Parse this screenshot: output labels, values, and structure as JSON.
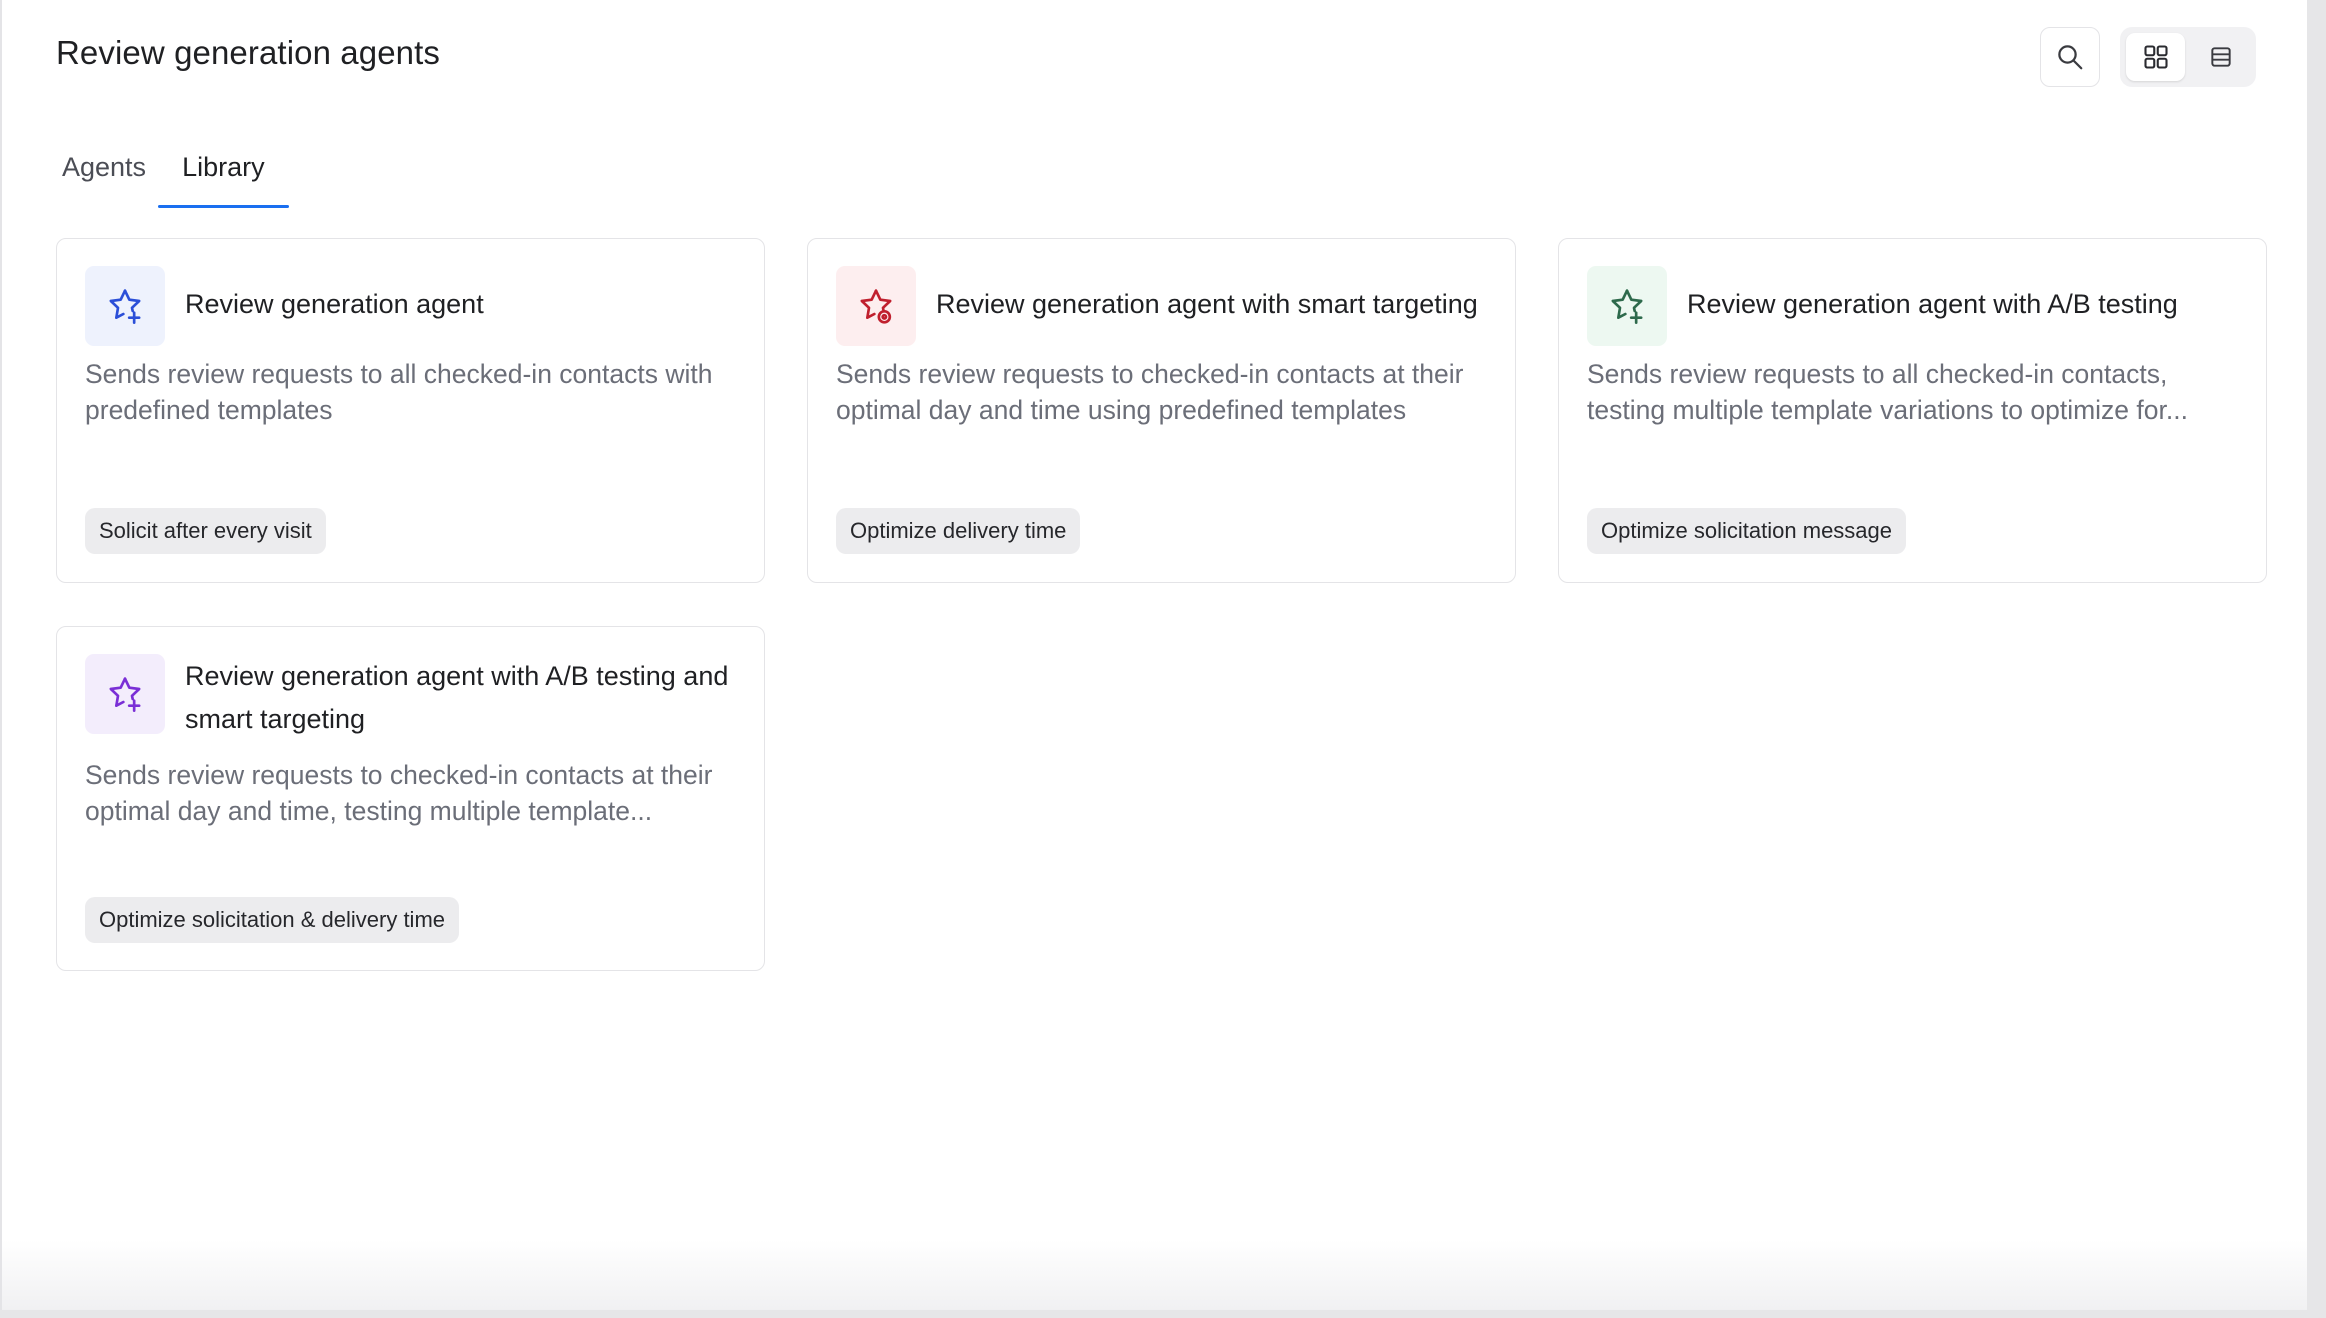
{
  "header": {
    "title": "Review generation agents",
    "search_icon": "search-icon",
    "view_options": [
      {
        "name": "grid-view",
        "icon": "grid-icon",
        "active": true
      },
      {
        "name": "list-view",
        "icon": "list-icon",
        "active": false
      }
    ]
  },
  "tabs": [
    {
      "label": "Agents",
      "active": false
    },
    {
      "label": "Library",
      "active": true
    }
  ],
  "colors": {
    "accent": "#1a6ff0",
    "blue_icon": "#2b4fd8",
    "blue_icon_bg": "#eef2fd",
    "red_icon": "#c0202e",
    "red_icon_bg": "#fdeeef",
    "green_icon": "#2e6a4c",
    "green_icon_bg": "#edf8f1",
    "purple_icon": "#7a2fd6",
    "purple_icon_bg": "#f3edfc"
  },
  "cards": [
    {
      "title": "Review generation agent",
      "description": "Sends review requests to all checked-in contacts with predefined templates",
      "badge": "Solicit after every visit",
      "icon": "sparkle-star-icon",
      "color": "blue"
    },
    {
      "title": "Review generation agent with smart targeting",
      "description": "Sends review requests to checked-in contacts at their optimal day and time using predefined templates",
      "badge": "Optimize delivery time",
      "icon": "target-star-icon",
      "color": "red"
    },
    {
      "title": "Review generation agent with A/B testing",
      "description": "Sends review requests to all checked-in contacts, testing multiple template variations to optimize for...",
      "badge": "Optimize solicitation message",
      "icon": "sparkle-star-icon",
      "color": "green"
    },
    {
      "title": "Review generation agent with A/B testing and smart targeting",
      "description": "Sends review requests to checked-in contacts at their optimal day and time, testing multiple template...",
      "badge": "Optimize solicitation & delivery time",
      "icon": "sparkle-star-icon",
      "color": "purple"
    }
  ]
}
